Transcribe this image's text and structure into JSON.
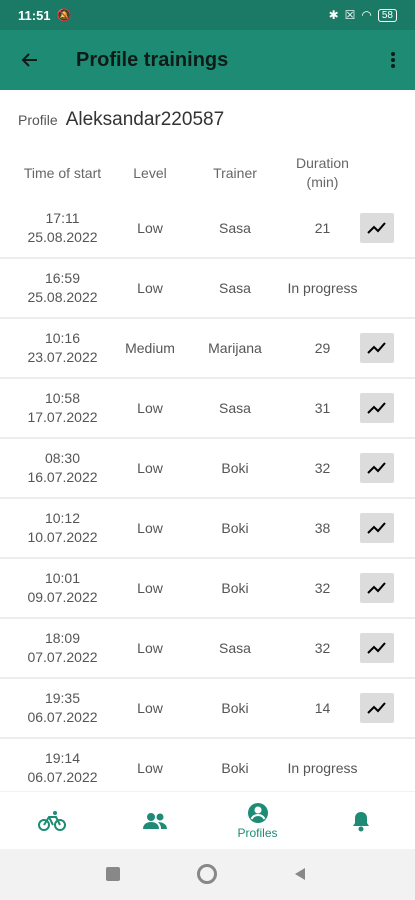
{
  "status": {
    "time": "11:51",
    "battery": "58"
  },
  "appbar": {
    "title": "Profile trainings"
  },
  "profile": {
    "label": "Profile",
    "name": "Aleksandar220587"
  },
  "columns": {
    "time": "Time of start",
    "level": "Level",
    "trainer": "Trainer",
    "duration": "Duration (min)"
  },
  "rows": [
    {
      "time": "17:11",
      "date": "25.08.2022",
      "level": "Low",
      "trainer": "Sasa",
      "duration": "21",
      "chart": true
    },
    {
      "time": "16:59",
      "date": "25.08.2022",
      "level": "Low",
      "trainer": "Sasa",
      "duration": "In progress",
      "chart": false
    },
    {
      "time": "10:16",
      "date": "23.07.2022",
      "level": "Medium",
      "trainer": "Marijana",
      "duration": "29",
      "chart": true
    },
    {
      "time": "10:58",
      "date": "17.07.2022",
      "level": "Low",
      "trainer": "Sasa",
      "duration": "31",
      "chart": true
    },
    {
      "time": "08:30",
      "date": "16.07.2022",
      "level": "Low",
      "trainer": "Boki",
      "duration": "32",
      "chart": true
    },
    {
      "time": "10:12",
      "date": "10.07.2022",
      "level": "Low",
      "trainer": "Boki",
      "duration": "38",
      "chart": true
    },
    {
      "time": "10:01",
      "date": "09.07.2022",
      "level": "Low",
      "trainer": "Boki",
      "duration": "32",
      "chart": true
    },
    {
      "time": "18:09",
      "date": "07.07.2022",
      "level": "Low",
      "trainer": "Sasa",
      "duration": "32",
      "chart": true
    },
    {
      "time": "19:35",
      "date": "06.07.2022",
      "level": "Low",
      "trainer": "Boki",
      "duration": "14",
      "chart": true
    },
    {
      "time": "19:14",
      "date": "06.07.2022",
      "level": "Low",
      "trainer": "Boki",
      "duration": "In progress",
      "chart": false
    }
  ],
  "nav": {
    "profiles_label": "Profiles"
  },
  "colors": {
    "primary": "#1e8c75",
    "statusbar": "#1a7a66"
  }
}
